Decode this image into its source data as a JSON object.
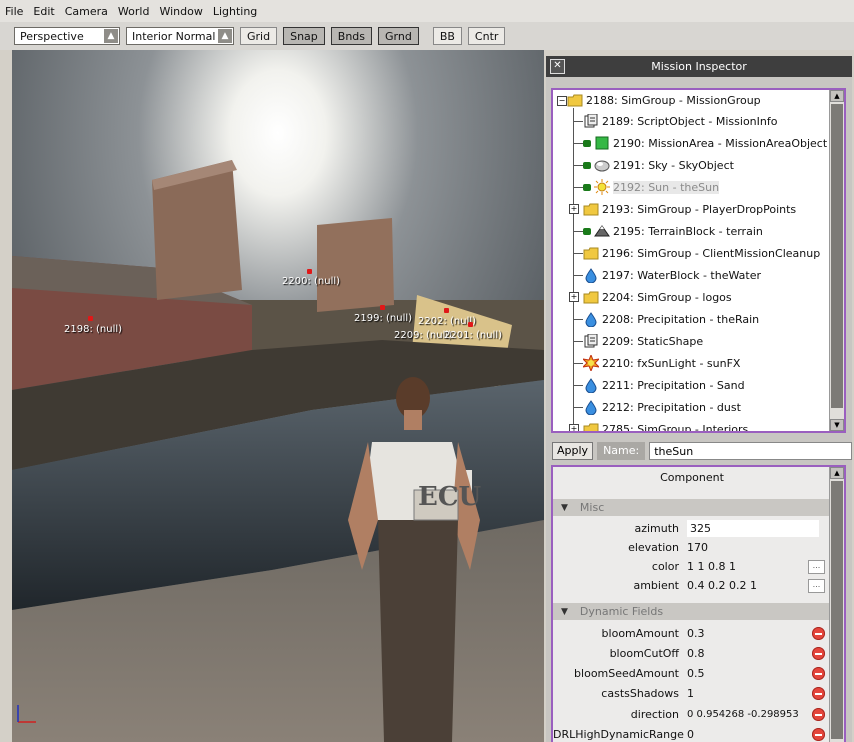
{
  "menu": [
    "File",
    "Edit",
    "Camera",
    "World",
    "Window",
    "Lighting"
  ],
  "toolbar": {
    "camera_mode": "Perspective",
    "render_mode": "Interior Normal",
    "buttons": [
      {
        "label": "Grid",
        "active": false
      },
      {
        "label": "Snap",
        "active": true
      },
      {
        "label": "Bnds",
        "active": true
      },
      {
        "label": "Grnd",
        "active": true
      },
      {
        "label": "BB",
        "active": false
      },
      {
        "label": "Cntr",
        "active": false
      }
    ]
  },
  "viewport": {
    "labels": [
      "2198: (null)",
      "2200: (null)",
      "2199: (null)",
      "2202: (null)",
      "2209: (null)",
      "2201: (null)"
    ],
    "shirt_text": "ECU"
  },
  "inspector": {
    "title": "Mission Inspector",
    "tree": [
      {
        "id": "2188",
        "text": "2188: SimGroup - MissionGroup",
        "icon": "folder-icon"
      },
      {
        "id": "2189",
        "text": "2189: ScriptObject - MissionInfo",
        "icon": "document-icon"
      },
      {
        "id": "2190",
        "text": "2190: MissionArea - MissionAreaObject",
        "icon": "mission-area-icon"
      },
      {
        "id": "2191",
        "text": "2191: Sky - SkyObject",
        "icon": "sky-icon"
      },
      {
        "id": "2192",
        "text": "2192: Sun - theSun",
        "icon": "sun-icon"
      },
      {
        "id": "2193",
        "text": "2193: SimGroup - PlayerDropPoints",
        "icon": "folder-icon"
      },
      {
        "id": "2195",
        "text": "2195: TerrainBlock - terrain",
        "icon": "terrain-icon"
      },
      {
        "id": "2196",
        "text": "2196: SimGroup - ClientMissionCleanup",
        "icon": "folder-icon"
      },
      {
        "id": "2197",
        "text": "2197: WaterBlock - theWater",
        "icon": "water-drop-icon"
      },
      {
        "id": "2204",
        "text": "2204: SimGroup - logos",
        "icon": "folder-icon"
      },
      {
        "id": "2208",
        "text": "2208: Precipitation - theRain",
        "icon": "water-drop-icon"
      },
      {
        "id": "2209",
        "text": "2209: StaticShape",
        "icon": "document-icon"
      },
      {
        "id": "2210",
        "text": "2210: fxSunLight - sunFX",
        "icon": "sunlight-icon"
      },
      {
        "id": "2211",
        "text": "2211: Precipitation - Sand",
        "icon": "water-drop-icon"
      },
      {
        "id": "2212",
        "text": "2212: Precipitation - dust",
        "icon": "water-drop-icon"
      },
      {
        "id": "2785",
        "text": "2785: SimGroup - Interiors",
        "icon": "folder-icon"
      }
    ],
    "apply_label": "Apply",
    "name_label": "Name:",
    "name_value": "theSun",
    "component_header": "Component",
    "misc_section": "Misc",
    "misc_fields": [
      {
        "name": "azimuth",
        "value": "325"
      },
      {
        "name": "elevation",
        "value": "170"
      },
      {
        "name": "color",
        "value": "1 1 0.8 1"
      },
      {
        "name": "ambient",
        "value": "0.4 0.2 0.2 1"
      }
    ],
    "dynamic_section": "Dynamic Fields",
    "dynamic_fields": [
      {
        "name": "bloomAmount",
        "value": "0.3"
      },
      {
        "name": "bloomCutOff",
        "value": "0.8"
      },
      {
        "name": "bloomSeedAmount",
        "value": "0.5"
      },
      {
        "name": "castsShadows",
        "value": "1"
      },
      {
        "name": "direction",
        "value": "0 0.954268 -0.298953"
      },
      {
        "name": "DRLHighDynamicRange",
        "value": "0"
      }
    ],
    "ellipsis_label": "..."
  },
  "colors": {
    "selection_border": "#9a5fbf",
    "title_bar": "#3e3e3e",
    "delete_button": "#e4453b"
  }
}
